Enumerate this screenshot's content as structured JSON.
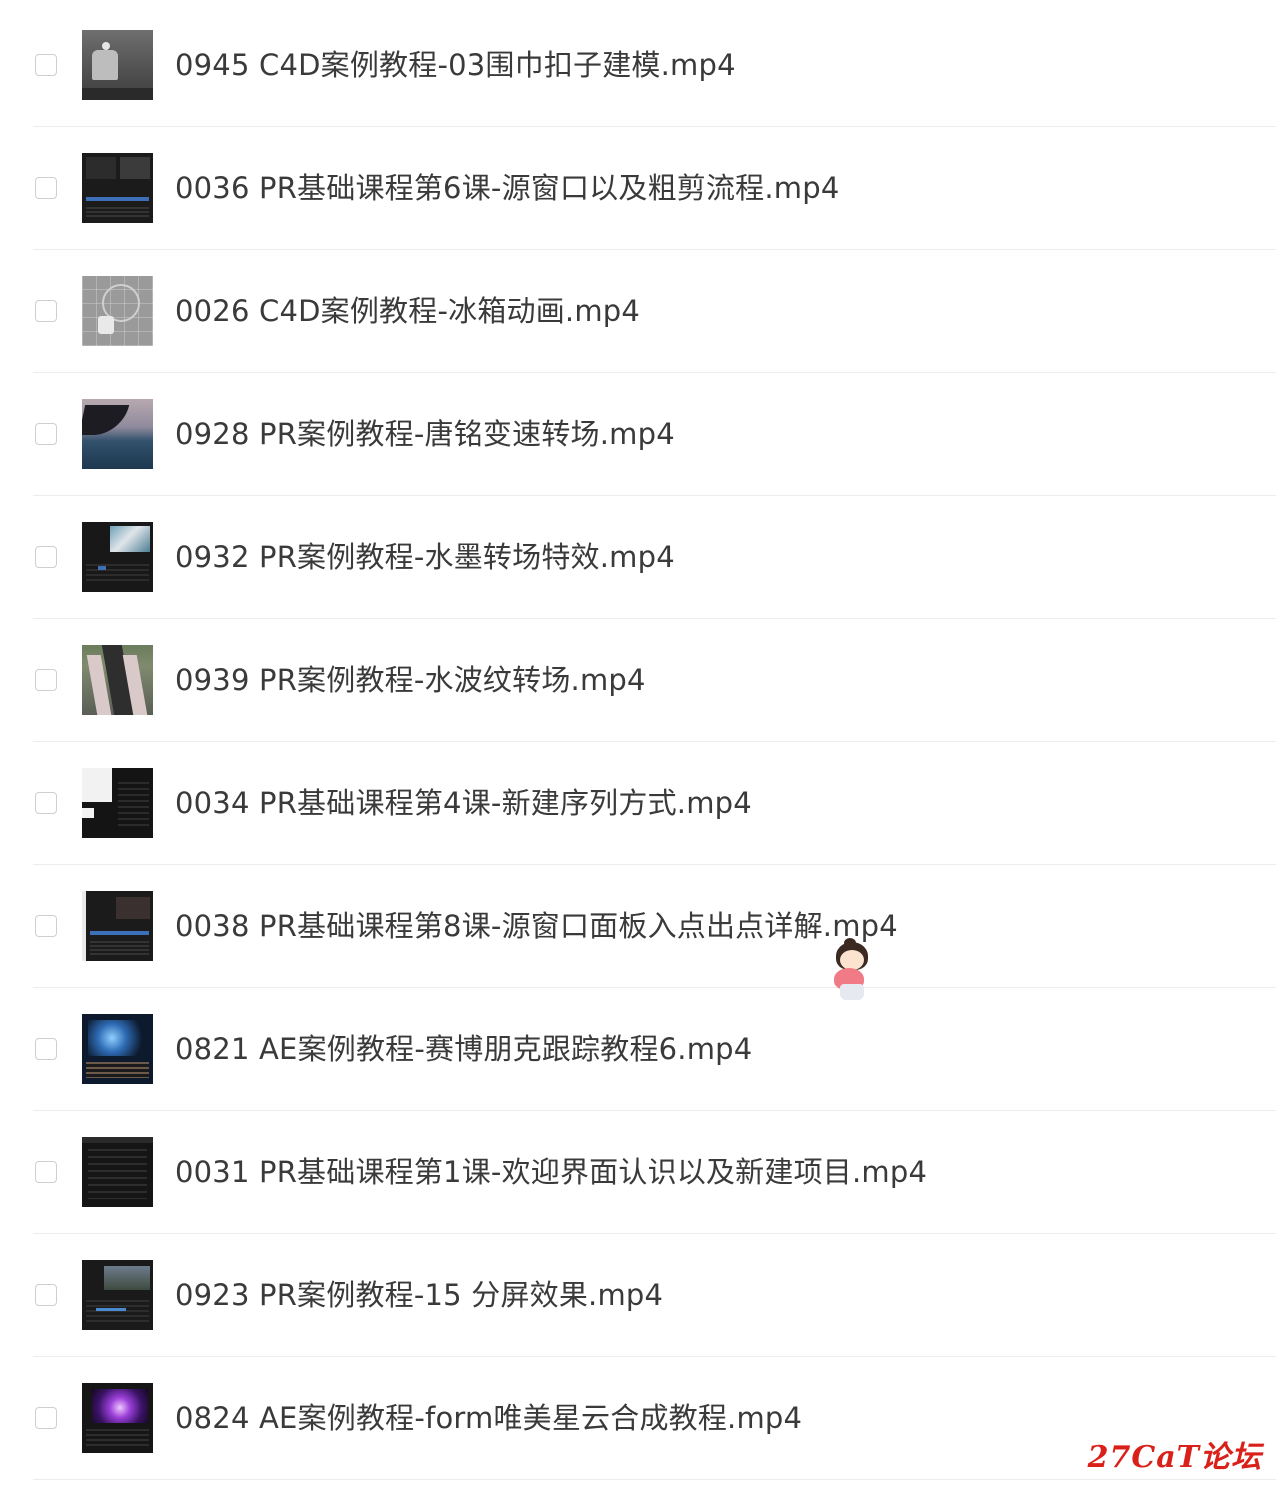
{
  "files": [
    {
      "name": "0945 C4D案例教程-03围巾扣子建模.mp4",
      "thumb": "c4d"
    },
    {
      "name": "0036 PR基础课程第6课-源窗口以及粗剪流程.mp4",
      "thumb": "pr"
    },
    {
      "name": "0026 C4D案例教程-冰箱动画.mp4",
      "thumb": "fridge"
    },
    {
      "name": "0928 PR案例教程-唐铭变速转场.mp4",
      "thumb": "sea"
    },
    {
      "name": "0932 PR案例教程-水墨转场特效.mp4",
      "thumb": "ink"
    },
    {
      "name": "0939 PR案例教程-水波纹转场.mp4",
      "thumb": "road"
    },
    {
      "name": "0034 PR基础课程第4课-新建序列方式.mp4",
      "thumb": "seq"
    },
    {
      "name": "0038 PR基础课程第8课-源窗口面板入点出点详解.mp4",
      "thumb": "pr8"
    },
    {
      "name": "0821 AE案例教程-赛博朋克跟踪教程6.mp4",
      "thumb": "cyber"
    },
    {
      "name": "0031 PR基础课程第1课-欢迎界面认识以及新建项目.mp4",
      "thumb": "welcome"
    },
    {
      "name": "0923 PR案例教程-15 分屏效果.mp4",
      "thumb": "split"
    },
    {
      "name": "0824 AE案例教程-form唯美星云合成教程.mp4",
      "thumb": "nebula"
    }
  ],
  "watermark": "27CaT论坛",
  "colors": {
    "text": "#3a3a3a",
    "divider": "#ececec",
    "checkbox_border": "#cfcfcf",
    "watermark": "#d9211a"
  }
}
